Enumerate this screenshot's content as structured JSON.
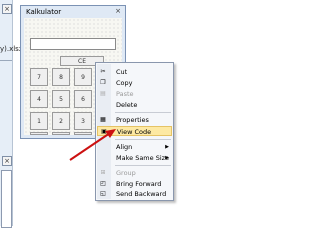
{
  "form": {
    "title": "Kalkulator",
    "buttons": {
      "ce": "CE",
      "rows": [
        [
          "7",
          "8",
          "9"
        ],
        [
          "4",
          "5",
          "6"
        ],
        [
          "1",
          "2",
          "3"
        ],
        [
          "0",
          ".",
          "="
        ]
      ],
      "op": "+"
    }
  },
  "left": {
    "cut_text": "y).xlsx"
  },
  "menu": {
    "items": [
      {
        "label": "Cut",
        "icon": "scissors-icon",
        "enabled": true
      },
      {
        "label": "Copy",
        "icon": "copy-icon",
        "enabled": true
      },
      {
        "label": "Paste",
        "icon": "paste-icon",
        "enabled": false
      },
      {
        "label": "Delete",
        "icon": "",
        "enabled": true
      },
      {
        "label": "Properties",
        "icon": "properties-icon",
        "enabled": true
      },
      {
        "label": "View Code",
        "icon": "view-code-icon",
        "enabled": true
      },
      {
        "label": "Align",
        "icon": "",
        "enabled": true,
        "submenu": true
      },
      {
        "label": "Make Same Size",
        "icon": "",
        "enabled": true,
        "submenu": true
      },
      {
        "label": "Group",
        "icon": "group-icon",
        "enabled": false
      },
      {
        "label": "Bring Forward",
        "icon": "bring-forward-icon",
        "enabled": true
      },
      {
        "label": "Send Backward",
        "icon": "send-backward-icon",
        "enabled": true
      }
    ],
    "highlighted": "View Code"
  },
  "colors": {
    "highlight": "#fde9a3",
    "arrow": "#cc1111"
  }
}
